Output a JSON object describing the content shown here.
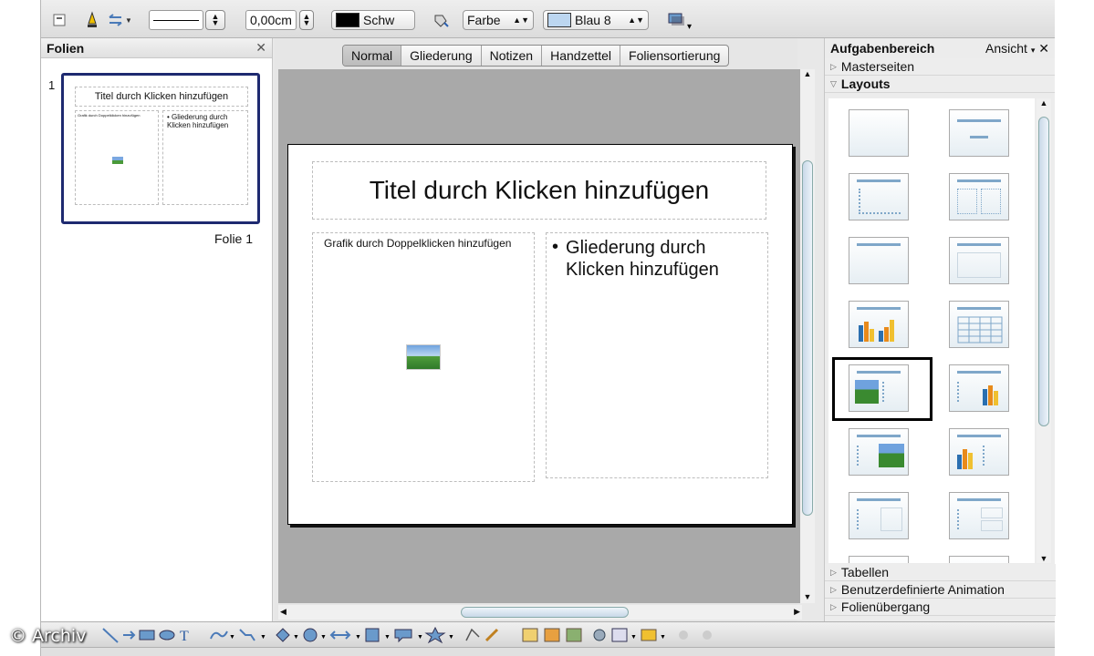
{
  "toolbar": {
    "line_width": "0,00cm",
    "line_color": "Schw",
    "area_style": "Farbe",
    "area_color": "Blau 8"
  },
  "slides_pane": {
    "title": "Folien",
    "thumb_number": "1",
    "thumb_title": "Titel durch Klicken hinzufügen",
    "thumb_left": "Grafik durch Doppelklicken hinzufügen",
    "thumb_right": "• Gliederung durch Klicken hinzufügen",
    "slide_label": "Folie 1"
  },
  "view_tabs": [
    "Normal",
    "Gliederung",
    "Notizen",
    "Handzettel",
    "Foliensortierung"
  ],
  "slide": {
    "title": "Titel durch Klicken hinzufügen",
    "left_placeholder": "Grafik durch Doppelklicken hinzufügen",
    "right_bullet": "•",
    "right_text": "Gliederung durch Klicken hinzufügen"
  },
  "task_pane": {
    "title": "Aufgabenbereich",
    "view_menu": "Ansicht",
    "sections_top": [
      "Masterseiten",
      "Layouts"
    ],
    "sections_bottom": [
      "Tabellen",
      "Benutzerdefinierte Animation",
      "Folienübergang"
    ]
  },
  "watermark": "© Archiv",
  "colors": {
    "accent": "#1e2a70",
    "selection": "#000000",
    "layout_bar": "#7fa7c9"
  }
}
